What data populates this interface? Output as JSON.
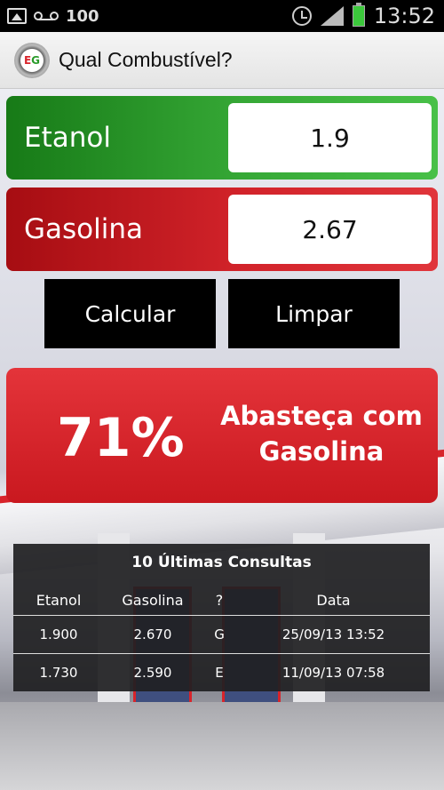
{
  "status_bar": {
    "left_count": "100",
    "time": "13:52",
    "icons": [
      "image-icon",
      "voicemail-icon",
      "alarm-icon",
      "signal-icon",
      "battery-icon"
    ]
  },
  "header": {
    "title": "Qual Combustível?",
    "logo_left": "E",
    "logo_right": "G"
  },
  "inputs": {
    "etanol_label": "Etanol",
    "etanol_value": "1.9",
    "gasolina_label": "Gasolina",
    "gasolina_value": "2.67"
  },
  "actions": {
    "calcular": "Calcular",
    "limpar": "Limpar"
  },
  "result": {
    "percent": "71%",
    "advice_line1": "Abasteça com",
    "advice_line2": "Gasolina"
  },
  "history": {
    "title": "10 Últimas Consultas",
    "columns": [
      "Etanol",
      "Gasolina",
      "?",
      "Data"
    ],
    "rows": [
      [
        "1.900",
        "2.670",
        "G",
        "25/09/13 13:52"
      ],
      [
        "1.730",
        "2.590",
        "E",
        "11/09/13 07:58"
      ]
    ]
  },
  "colors": {
    "etanol_green": "#2a9a2a",
    "gasolina_red": "#d2232a",
    "result_red": "#d41f26"
  }
}
